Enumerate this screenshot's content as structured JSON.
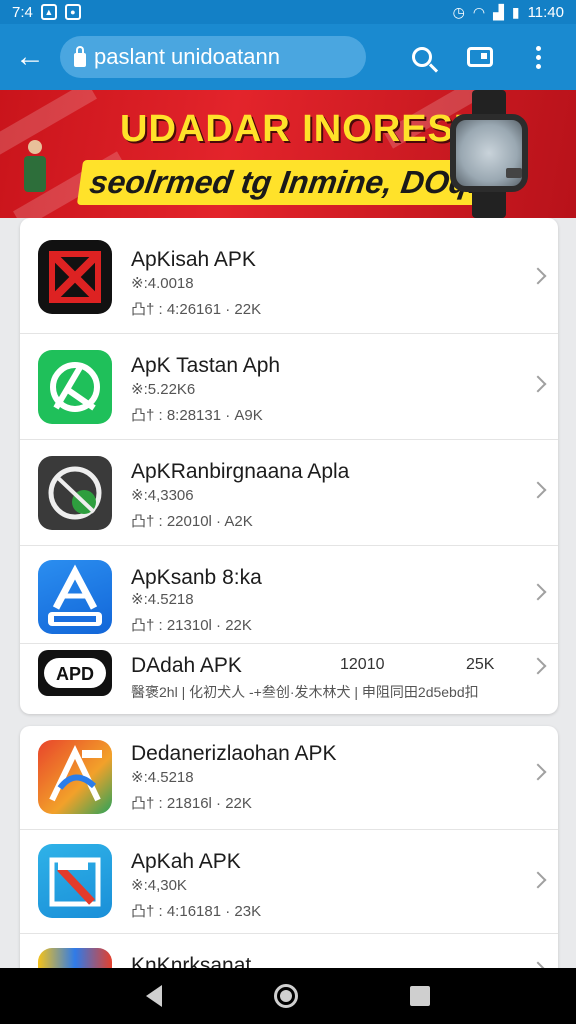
{
  "status_bar": {
    "time_left": "7:4",
    "time_right": "11:40"
  },
  "app_bar": {
    "url_text": "paslant unidoatann"
  },
  "banner": {
    "title": "UDADAR INORESI",
    "subtitle": "seolrmed tg Inmine, DOq!"
  },
  "list": {
    "card1": [
      {
        "name": "ApKisah APK",
        "size": "※:4.0018",
        "meta": "凸† : 4:26161 · 22K"
      },
      {
        "name": "ApK Tastan Aph",
        "size": "※:5.22K6",
        "meta": "凸† : 8:28131 · A9K"
      },
      {
        "name": "ApKRanbirgnaana Apla",
        "size": "※:4,3306",
        "meta": "凸† : 22010l · A2K"
      },
      {
        "name": "ApKsanb 8:ka",
        "size": "※:4.5218",
        "meta": "凸† : 21310l · 22K"
      },
      {
        "name": "DAdah APK",
        "num": "12010",
        "count": "25K",
        "meta_long": "醫褒2hl | 化初犬人 -+叁创·发木林犬 | 申阻同田2d5ebd扣"
      }
    ],
    "card2": [
      {
        "name": "Dedanerizlaohan APK",
        "size": "※:4.5218",
        "meta": "凸† : 21816l · 22K"
      },
      {
        "name": "ApKah APK",
        "size": "※:4,30K",
        "meta": "凸† : 4:16181 · 23K"
      },
      {
        "name": "KnKnrksanat",
        "size": "",
        "meta": ""
      }
    ]
  },
  "colors": {
    "app_bar": "#1a8ad0",
    "status_bar": "#1380c6",
    "banner_red": "#e3242b",
    "banner_yellow": "#ffe22a"
  }
}
